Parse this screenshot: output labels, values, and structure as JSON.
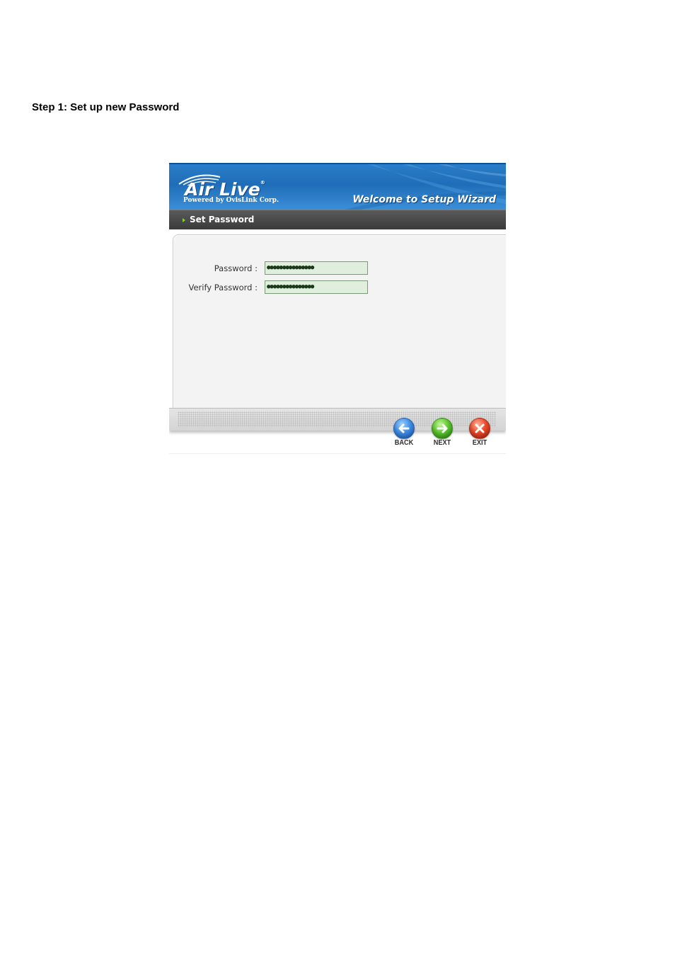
{
  "page": {
    "heading": "Step 1: Set up new Password"
  },
  "wizard": {
    "brand_name": "Air Live",
    "brand_tagline": "Powered by OvisLink Corp.",
    "welcome": "Welcome to Setup Wizard",
    "section_title": "Set Password",
    "fields": [
      {
        "label": "Password :",
        "value": "●●●●●●●●●●●●●●●"
      },
      {
        "label": "Verify Password :",
        "value": "●●●●●●●●●●●●●●●"
      }
    ],
    "buttons": {
      "back": "BACK",
      "next": "NEXT",
      "exit": "EXIT"
    },
    "colors": {
      "banner_blue": "#1f6db8",
      "section_bar": "#3a3a3a",
      "panel_bg": "#f3f3f3",
      "input_bg": "#dfeedd",
      "back_blue": "#3f8ee6",
      "next_green": "#5cc62d",
      "exit_red": "#ea4a2a"
    }
  }
}
